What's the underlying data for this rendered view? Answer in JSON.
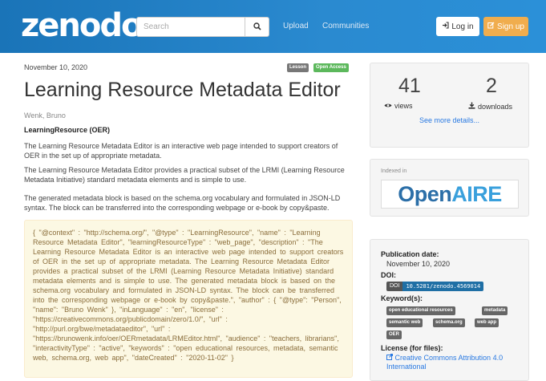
{
  "header": {
    "logo": "zenodo",
    "search_placeholder": "Search",
    "nav": [
      "Upload",
      "Communities"
    ],
    "login_label": "Log in",
    "signup_label": "Sign up"
  },
  "record": {
    "date": "November 10, 2020",
    "badges": [
      "Lesson",
      "Open Access"
    ],
    "title": "Learning Resource Metadata Editor",
    "author": "Wenk, Bruno",
    "resource_type": "LearningResource (OER)",
    "paragraphs": [
      "The Learning Resource Metadata Editor is an interactive web page intended to support creators of OER in the set up of appropriate metadata.",
      "The Learning Resource Metadata Editor provides a practical subset of the LRMI (Learning Resource Metadata Initiative) standard metadata elements and is simple to use.",
      "The generated metadata block is based on the schema.org vocabulary and formulated in JSON-LD syntax. The block can be transferred into the corresponding webpage or e-book by copy&paste."
    ],
    "json_ld": "{      \"@context\" : \"http://schema.org/\",      \"@type\" : \"LearningResource\",      \"name\" : \"Learning Resource Metadata Editor\",      \"learningResourceType\" : \"web_page\",      \"description\" : \"The Learning Resource Metadata Editor is an interactive web page intended to support creators of OER in the set up of appropriate metadata.      The Learning Resource Metadata Editor provides a practical subset of the LRMI (Learning Resource Metadata Initiative) standard metadata elements and is simple to use.      The generated metadata block is based on the schema.org vocabulary and formulated in JSON-LD syntax. The block can be transferred into the corresponding webpage or e-book by copy&paste.\",      \"author\" : {      \"@type\": \"Person\",      \"name\": \"Bruno Wenk\"      },      \"inLanguage\" : \"en\",      \"license\" : \"https://creativecommons.org/publicdomain/zero/1.0/\",      \"url\" : \"http://purl.org/bwe/metadataeditor\",      \"url\" : \"https://brunowenk.info/oer/OERmetadata/LRMEditor.html\",      \"audience\" : \"teachers, librarians\",      \"interactivityType\" : \"active\",      \"keywords\" : \"open educational resources, metadata, semantic web, schema.org, web app\",      \"dateCreated\" : \"2020-11-02\"      }"
  },
  "sidebar": {
    "views_count": "41",
    "views_label": "views",
    "downloads_count": "2",
    "downloads_label": "downloads",
    "see_more": "See more details...",
    "indexed_in": "Indexed in",
    "openaire_open": "Open",
    "openaire_aire": "AIRE",
    "pub_date_label": "Publication date:",
    "pub_date": "November 10, 2020",
    "doi_label": "DOI:",
    "doi_key": "DOI",
    "doi_value": "10.5281/zenodo.4569014",
    "keywords_label": "Keyword(s):",
    "keywords": [
      "open educational resources",
      "metadata",
      "semantic web",
      "schema.org",
      "web app",
      "OER"
    ],
    "license_label": "License (for files):",
    "license_value": "Creative Commons Attribution 4.0 International"
  },
  "colors": {
    "header": "#2584c8",
    "signup": "#f0ad4e",
    "open_access": "#5cb85c",
    "link": "#2a7ae2",
    "doi_value_bg": "#1f6fa5"
  },
  "icons": [
    "search-icon",
    "login-icon",
    "edit-icon",
    "eye-icon",
    "download-icon",
    "external-link-icon"
  ]
}
